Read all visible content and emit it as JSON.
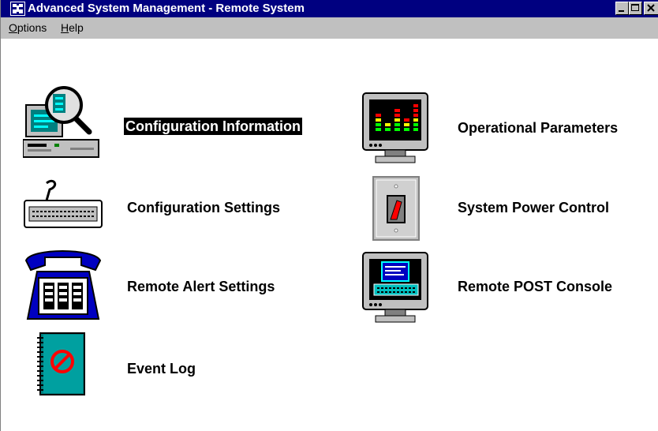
{
  "window": {
    "title": "Advanced System Management - Remote System"
  },
  "menubar": {
    "items": [
      {
        "label": "Options",
        "mnemonic": "O",
        "rest": "ptions"
      },
      {
        "label": "Help",
        "mnemonic": "H",
        "rest": "elp"
      }
    ]
  },
  "main": {
    "items": [
      {
        "label": "Configuration Information",
        "icon": "magnifier-computer-icon",
        "selected": true
      },
      {
        "label": "Operational Parameters",
        "icon": "monitor-bars-icon",
        "selected": false
      },
      {
        "label": "Configuration Settings",
        "icon": "keyboard-icon",
        "selected": false
      },
      {
        "label": "System Power Control",
        "icon": "power-switch-icon",
        "selected": false
      },
      {
        "label": "Remote Alert Settings",
        "icon": "telephone-icon",
        "selected": false
      },
      {
        "label": "Remote POST Console",
        "icon": "monitor-console-icon",
        "selected": false
      },
      {
        "label": "Event Log",
        "icon": "notebook-icon",
        "selected": false
      }
    ]
  },
  "colors": {
    "titlebar": "#000080",
    "menubar": "#c0c0c0",
    "selection": "#000000",
    "accent_teal": "#008080"
  }
}
